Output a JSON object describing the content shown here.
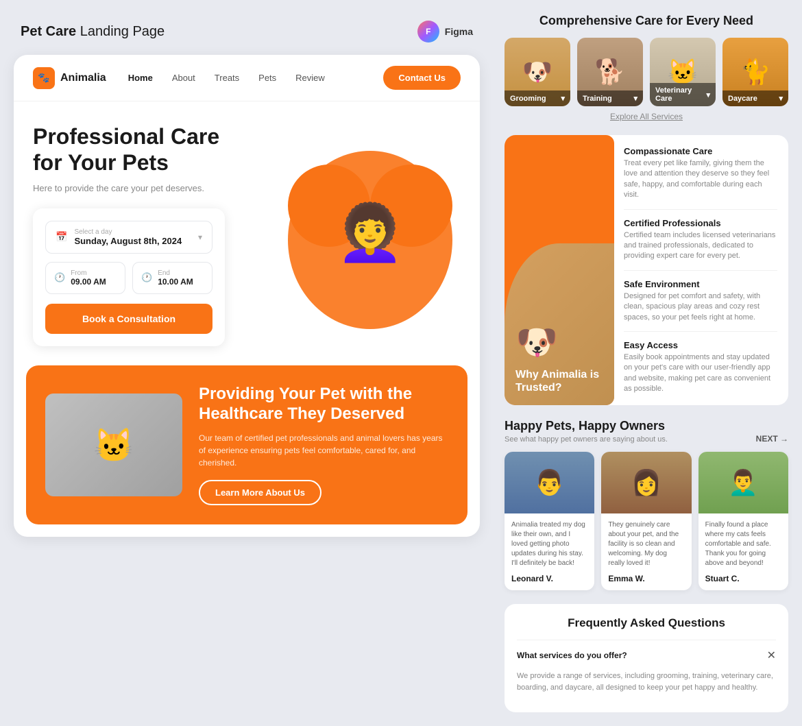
{
  "pageTitle": {
    "bold": "Pet Care",
    "normal": " Landing Page"
  },
  "figma": {
    "label": "Figma"
  },
  "navbar": {
    "logo": "Animalia",
    "links": [
      "Home",
      "About",
      "Treats",
      "Pets",
      "Review"
    ],
    "activeLink": "Home",
    "contactButton": "Contact Us"
  },
  "hero": {
    "title1": "Professional Care",
    "title2": "for Your Pets",
    "subtitle": "Here to provide the care your pet deserves.",
    "booking": {
      "dateLabel": "Select a day",
      "dateValue": "Sunday, August 8th, 2024",
      "fromLabel": "From",
      "fromTime": "09.00 AM",
      "endLabel": "End",
      "endTime": "10.00 AM",
      "buttonLabel": "Book a Consultation"
    }
  },
  "bottomCard": {
    "title": "Providing Your Pet with the Healthcare They Deserved",
    "text": "Our team of certified pet professionals and animal lovers has years of experience ensuring pets feel comfortable, cared for, and cherished.",
    "buttonLabel": "Learn More About Us"
  },
  "rightPanel": {
    "servicesTitle": "Comprehensive Care for Every Need",
    "services": [
      {
        "label": "Grooming",
        "emoji": "🐶"
      },
      {
        "label": "Training",
        "emoji": "🐕"
      },
      {
        "label": "Veterinary Care",
        "emoji": "🐱"
      },
      {
        "label": "Daycare",
        "emoji": "🐈"
      }
    ],
    "exploreLink": "Explore All Services",
    "whyTitle": "Why Animalia is Trusted?",
    "whyItems": [
      {
        "title": "Compassionate Care",
        "text": "Treat every pet like family, giving them the love and attention they deserve so they feel safe, happy, and comfortable during each visit."
      },
      {
        "title": "Certified Professionals",
        "text": "Certified team includes licensed veterinarians and trained professionals, dedicated to providing expert care for every pet."
      },
      {
        "title": "Safe Environment",
        "text": "Designed for pet comfort and safety, with clean, spacious play areas and cozy rest spaces, so your pet feels right at home."
      },
      {
        "title": "Easy Access",
        "text": "Easily book appointments and stay updated on your pet's care with our user-friendly app and website, making pet care as convenient as possible."
      }
    ],
    "testimonialsTitle": "Happy Pets, Happy Owners",
    "testimonialsSubtitle": "See what happy pet owners are saying about us.",
    "nextLabel": "NEXT →",
    "testimonials": [
      {
        "name": "Leonard V.",
        "text": "Animalia treated my dog like their own, and I loved getting photo updates during his stay. I'll definitely be back!"
      },
      {
        "name": "Emma W.",
        "text": "They genuinely care about your pet, and the facility is so clean and welcoming. My dog really loved it!"
      },
      {
        "name": "Stuart C.",
        "text": "Finally found a place where my cats feels comfortable and safe. Thank you for going above and beyond!"
      }
    ],
    "faqTitle": "Frequently Asked Questions",
    "faqItems": [
      {
        "question": "What services do you offer?",
        "answer": "We provide a range of services, including grooming, training, veterinary care, boarding, and daycare, all designed to keep your pet happy and healthy.",
        "open": true
      }
    ]
  }
}
